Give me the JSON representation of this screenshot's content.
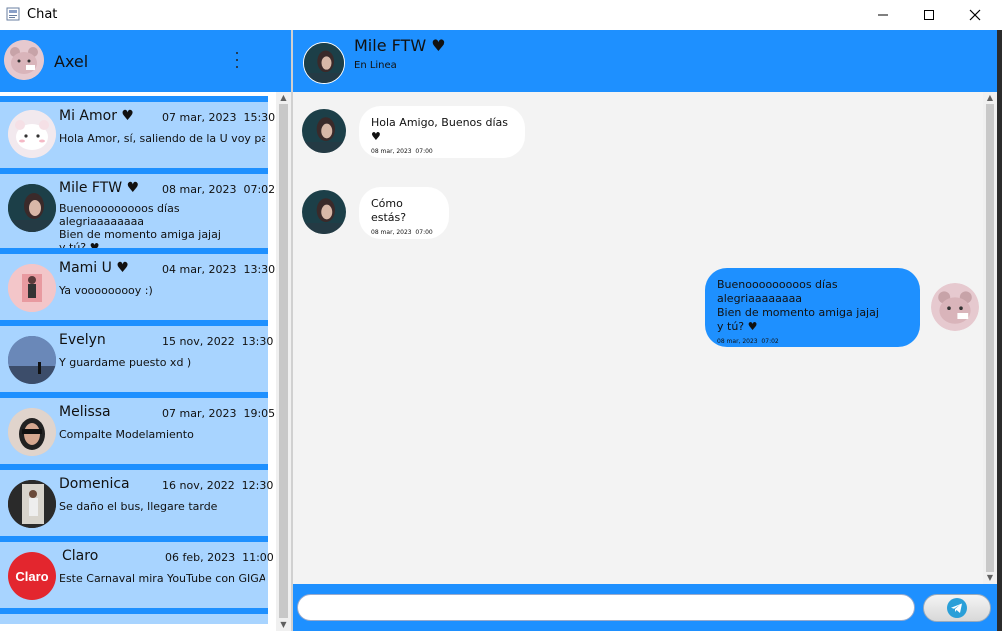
{
  "window": {
    "title": "Chat"
  },
  "me": {
    "name": "Axel"
  },
  "contacts": [
    {
      "name": "Mi Amor ♥",
      "date": "07 mar, 2023  15:30",
      "message": "Hola Amor, sí, saliendo de la U voy par...",
      "avatar": "avatar-bear"
    },
    {
      "name": "Mile FTW ♥",
      "date": "08 mar, 2023  07:02",
      "message": "Buenooooooooos días alegriaaaaaaaa\n Bien de momento amiga jajaj\n  y tú? ♥",
      "avatar": "avatar-girl"
    },
    {
      "name": "Mami U ♥",
      "date": "04 mar, 2023  13:30",
      "message": "Ya vooooooooy :)",
      "avatar": "avatar-pink"
    },
    {
      "name": "Evelyn",
      "date": "15 nov, 2022  13:30",
      "message": "Y guardame puesto xd )",
      "avatar": "avatar-sky"
    },
    {
      "name": "Melissa",
      "date": "07 mar, 2023  19:05",
      "message": "Compalte Modelamiento",
      "avatar": "avatar-sunglasses"
    },
    {
      "name": "Domenica",
      "date": "16 nov, 2022  12:30",
      "message": "Se daño el bus, llegare tarde",
      "avatar": "avatar-mirror"
    },
    {
      "name": "Claro",
      "date": "06 feb, 2023  11:00",
      "message": "Este Carnaval mira YouTube con GIGA...",
      "avatar": "avatar-claro",
      "avatar_text": "Claro"
    }
  ],
  "active_chat": {
    "name": "Mile FTW ♥",
    "status": "En Linea",
    "messages": [
      {
        "direction": "incoming",
        "text": "Hola Amigo, Buenos días ♥",
        "time": "08 mar, 2023  07:00"
      },
      {
        "direction": "incoming",
        "text": "Cómo estás?",
        "time": "08 mar, 2023  07:00"
      },
      {
        "direction": "outgoing",
        "text": "Buenooooooooos días alegriaaaaaaaa\n Bien de momento amiga jajaj\n  y tú? ♥",
        "time": "08 mar, 2023  07:02"
      }
    ]
  },
  "composer": {
    "value": "",
    "placeholder": ""
  },
  "colors": {
    "accent": "#1e90ff",
    "contact_bg": "#a8d4ff",
    "chat_bg": "#f3f3f3",
    "bubble_in": "#ffffff",
    "bubble_out": "#1e90ff"
  }
}
